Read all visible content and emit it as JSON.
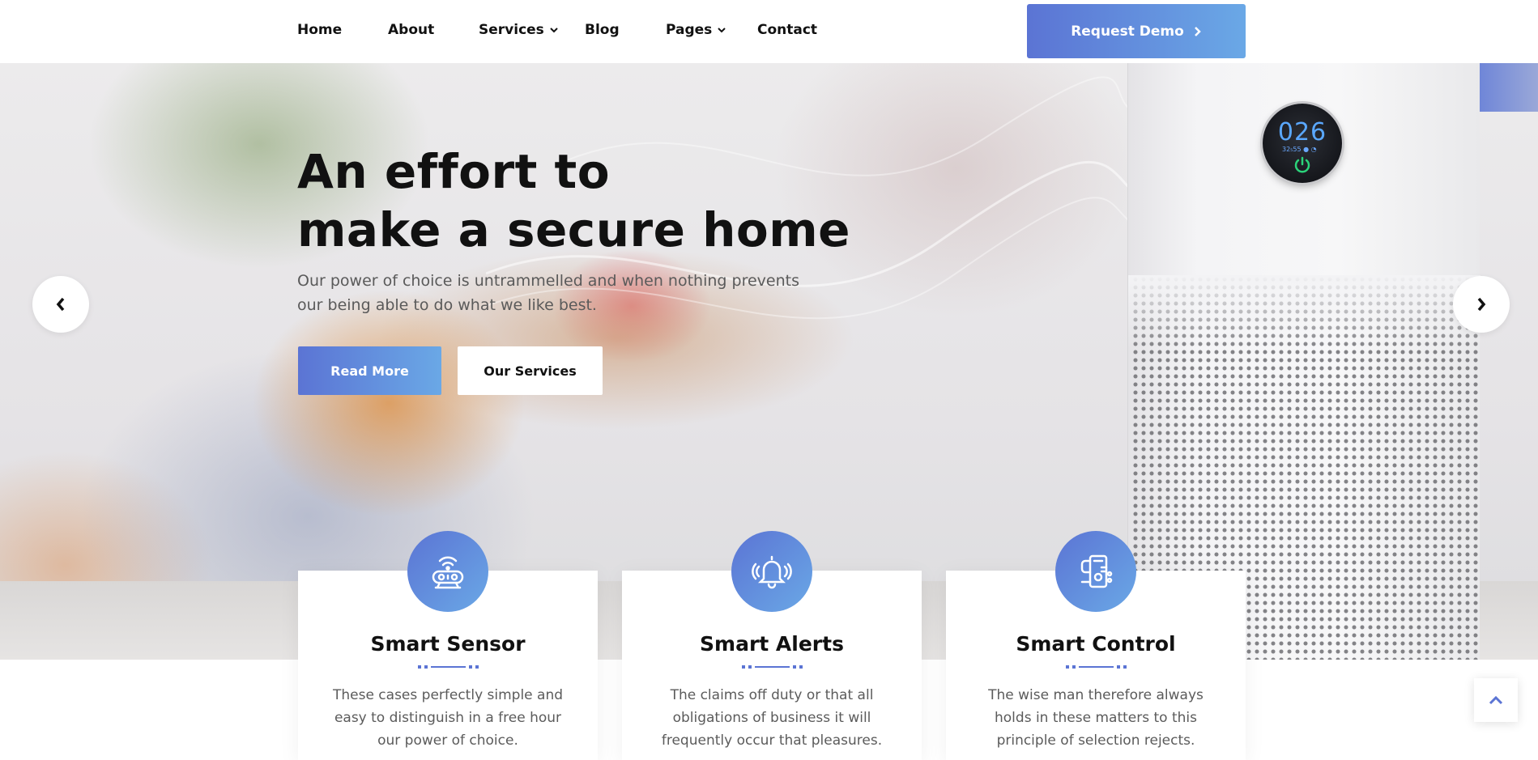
{
  "nav": {
    "items": [
      {
        "label": "Home",
        "has_dropdown": false
      },
      {
        "label": "About",
        "has_dropdown": false
      },
      {
        "label": "Services",
        "has_dropdown": true
      },
      {
        "label": "Blog",
        "has_dropdown": false
      },
      {
        "label": "Pages",
        "has_dropdown": true
      },
      {
        "label": "Contact",
        "has_dropdown": false
      }
    ],
    "cta_label": "Request Demo"
  },
  "hero": {
    "title_line1": "An effort to",
    "title_line2": "make a secure home",
    "description": "Our power of choice is untrammelled and when nothing prevents our being able to do what we like best.",
    "primary_button": "Read More",
    "secondary_button": "Our Services",
    "display_reading": "026",
    "display_sub": "32₅55 ● ◔"
  },
  "cards": [
    {
      "title": "Smart Sensor",
      "text": "These cases perfectly simple and easy to distinguish in a free hour our power of choice.",
      "icon": "sensor-icon"
    },
    {
      "title": "Smart Alerts",
      "text": "The claims off duty or that all obligations of business it will frequently occur that pleasures.",
      "icon": "bell-icon"
    },
    {
      "title": "Smart Control",
      "text": "The wise man therefore always holds in these matters to this principle of selection rejects.",
      "icon": "control-icon"
    }
  ],
  "colors": {
    "accent_start": "#5b74d4",
    "accent_end": "#6aa8e6",
    "text_dark": "#111111",
    "text_muted": "#5b5b5b"
  }
}
